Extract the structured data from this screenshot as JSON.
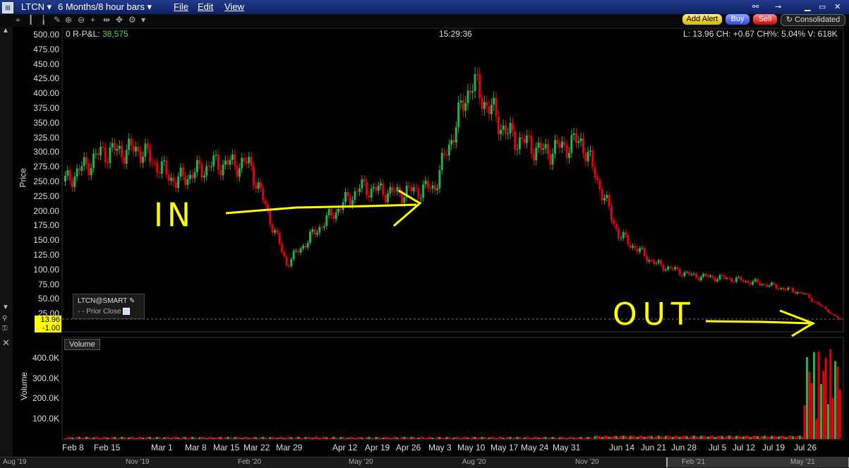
{
  "window": {
    "symbol": "LTCN",
    "period": "6 Months/8 hour bars",
    "menus": [
      "File",
      "Edit",
      "View"
    ],
    "buttons": {
      "add_alert": "Add Alert",
      "buy": "Buy",
      "sell": "Sell"
    },
    "consolidated": "Consolidated"
  },
  "header": {
    "pnl_label": "0 R-P&L:",
    "pnl_value": "38,575",
    "time": "15:29:36",
    "quote": "L: 13.96 CH: +0.67 CH%: 5.04% V: 618K"
  },
  "price_axis": {
    "label": "Price",
    "ticks": [
      "500.00",
      "475.00",
      "450.00",
      "425.00",
      "400.00",
      "375.00",
      "350.00",
      "325.00",
      "300.00",
      "275.00",
      "250.00",
      "225.00",
      "200.00",
      "175.00",
      "150.00",
      "125.00",
      "100.00",
      "75.00",
      "50.00",
      "25.00"
    ],
    "last_price_badge": "13.96",
    "prior_close_badge": "-1.00"
  },
  "legend": {
    "symbol": "LTCN@SMART",
    "prior_close": "Prior Close"
  },
  "volume_panel": {
    "title": "Volume",
    "label": "Volume",
    "ticks": [
      "400.0K",
      "300.0K",
      "200.0K",
      "100.0K"
    ]
  },
  "date_axis": [
    "Feb 8",
    "Feb 15",
    "Mar 1",
    "Mar 8",
    "Mar 15",
    "Mar 22",
    "Mar 29",
    "Apr 12",
    "Apr 19",
    "Apr 26",
    "May 3",
    "May 10",
    "May 17",
    "May 24",
    "May 31",
    "Jun 14",
    "Jun 21",
    "Jun 28",
    "Jul 5",
    "Jul 12",
    "Jul 19",
    "Jul 26"
  ],
  "nav_axis": [
    "Aug '19",
    "Nov '19",
    "Feb '20",
    "May '20",
    "Aug '20",
    "Nov '20",
    "Feb '21",
    "May '21"
  ],
  "handwritten": {
    "in": "IN",
    "out": "OUT"
  },
  "colors": {
    "up": "#22b14c",
    "down": "#e00010",
    "annotation": "#ffff00",
    "pnl": "#5fd35f"
  },
  "chart_data": {
    "type": "candlestick",
    "price_close_path": [
      [
        "Feb 8",
        250
      ],
      [
        "Feb 15",
        300
      ],
      [
        "Mar 1",
        305
      ],
      [
        "Mar 8",
        250
      ],
      [
        "Mar 15",
        280
      ],
      [
        "Mar 22",
        280
      ],
      [
        "Mar 29",
        110
      ],
      [
        "Apr 12",
        180
      ],
      [
        "Apr 19",
        240
      ],
      [
        "Apr 26",
        230
      ],
      [
        "May 3",
        240
      ],
      [
        "May 10",
        420
      ],
      [
        "May 17",
        330
      ],
      [
        "May 24",
        300
      ],
      [
        "May 31",
        320
      ],
      [
        "Jun 14",
        160
      ],
      [
        "Jun 21",
        110
      ],
      [
        "Jun 28",
        90
      ],
      [
        "Jul 5",
        85
      ],
      [
        "Jul 12",
        75
      ],
      [
        "Jul 19",
        60
      ],
      [
        "Jul 26",
        15
      ]
    ],
    "volume_approx": [
      [
        "Jul 19",
        40000
      ],
      [
        "Jul 26",
        470000
      ]
    ],
    "ylim": [
      0,
      500
    ]
  }
}
